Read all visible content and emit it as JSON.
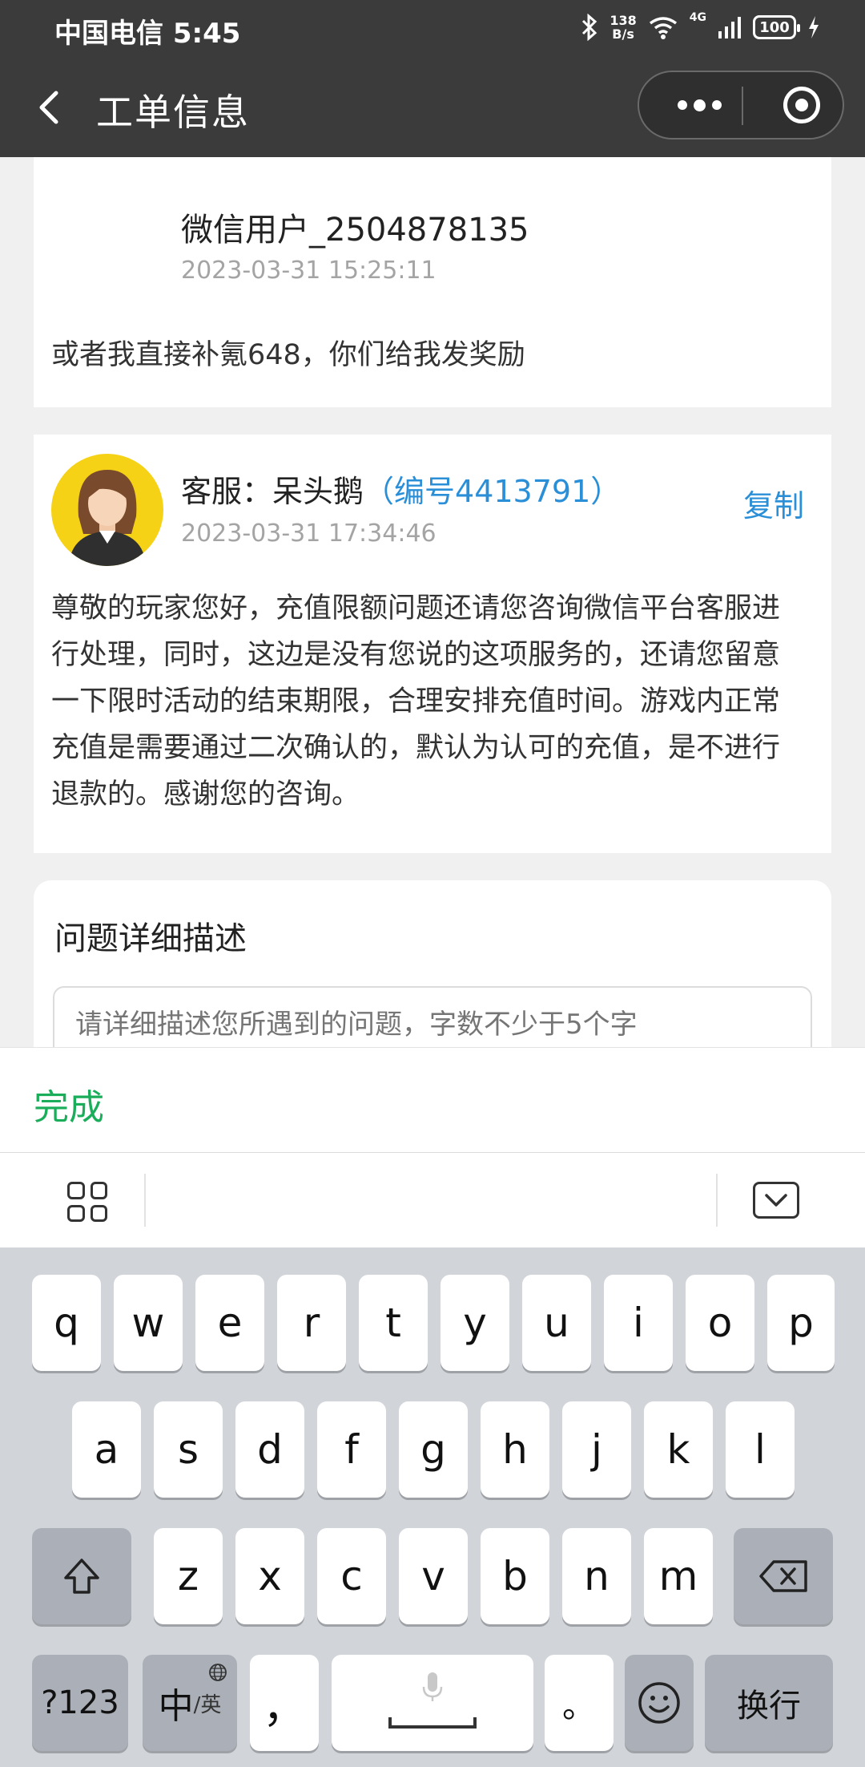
{
  "status_bar": {
    "carrier_time": "中国电信 5:45",
    "net_speed_value": "138",
    "net_speed_unit": "B/s",
    "network": "4G",
    "battery": "100"
  },
  "nav": {
    "title": "工单信息"
  },
  "ticket": {
    "user_message": {
      "username": "微信用户_2504878135",
      "time": "2023-03-31 15:25:11",
      "text": "或者我直接补氪648，你们给我发奖励"
    },
    "agent_reply": {
      "agent_label": "客服：呆头鹅",
      "agent_id": "（编号4413791）",
      "copy_label": "复制",
      "time": "2023-03-31 17:34:46",
      "text": "尊敬的玩家您好，充值限额问题还请您咨询微信平台客服进行处理，同时，这边是没有您说的这项服务的，还请您留意一下限时活动的结束期限，合理安排充值时间。游戏内正常充值是需要通过二次确认的，默认为认可的充值，是不进行退款的。感谢您的咨询。"
    }
  },
  "detail_section": {
    "title": "问题详细描述",
    "placeholder": "请详细描述您所遇到的问题，字数不少于5个字"
  },
  "done_label": "完成",
  "keyboard": {
    "row1": [
      "q",
      "w",
      "e",
      "r",
      "t",
      "y",
      "u",
      "i",
      "o",
      "p"
    ],
    "row2": [
      "a",
      "s",
      "d",
      "f",
      "g",
      "h",
      "j",
      "k",
      "l"
    ],
    "row3": [
      "z",
      "x",
      "c",
      "v",
      "b",
      "n",
      "m"
    ],
    "num_key": "?123",
    "lang_key_main": "中",
    "lang_key_sub": "/英",
    "comma_key": "，",
    "period_key": "。",
    "enter_key": "换行"
  }
}
